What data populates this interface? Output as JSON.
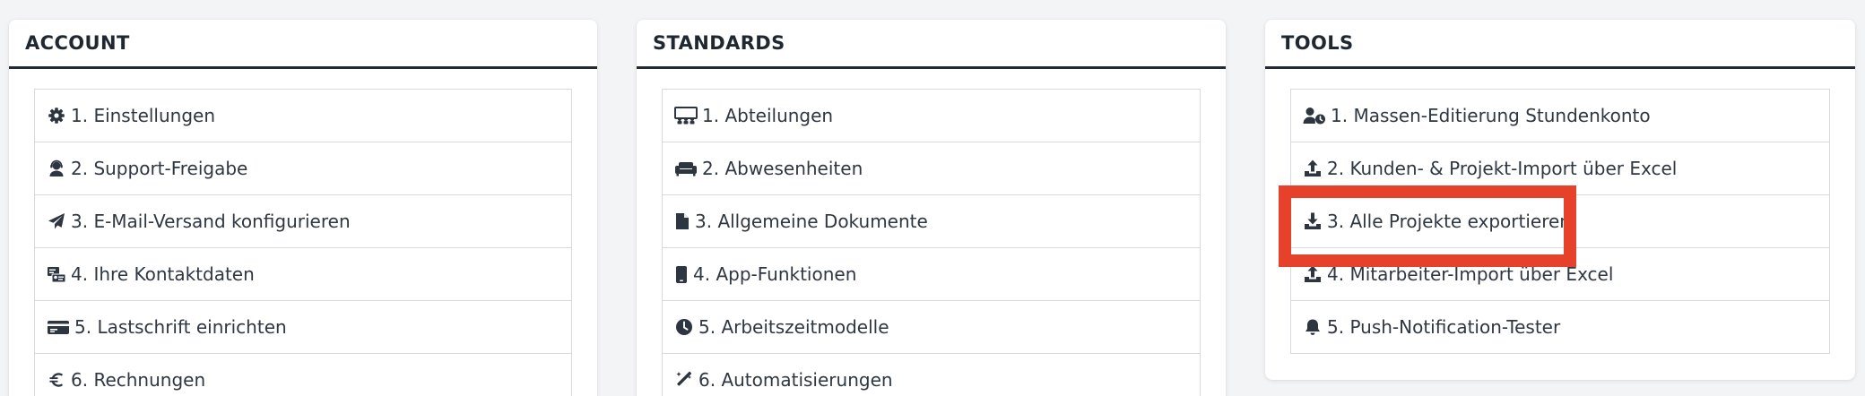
{
  "panels": [
    {
      "title": "ACCOUNT",
      "items": [
        {
          "label": "1. Einstellungen",
          "icon": "gear-icon"
        },
        {
          "label": "2. Support-Freigabe",
          "icon": "user-headset-icon"
        },
        {
          "label": "3. E-Mail-Versand konfigurieren",
          "icon": "paper-plane-icon"
        },
        {
          "label": "4. Ihre Kontaktdaten",
          "icon": "contact-card-icon"
        },
        {
          "label": "5. Lastschrift einrichten",
          "icon": "credit-card-icon"
        },
        {
          "label": "6. Rechnungen",
          "icon": "euro-icon"
        }
      ]
    },
    {
      "title": "STANDARDS",
      "items": [
        {
          "label": "1. Abteilungen",
          "icon": "presentation-icon"
        },
        {
          "label": "2. Abwesenheiten",
          "icon": "couch-icon"
        },
        {
          "label": "3. Allgemeine Dokumente",
          "icon": "file-icon"
        },
        {
          "label": "4. App-Funktionen",
          "icon": "mobile-icon"
        },
        {
          "label": "5. Arbeitszeitmodelle",
          "icon": "clock-icon"
        },
        {
          "label": "6. Automatisierungen",
          "icon": "magic-wand-icon"
        }
      ]
    },
    {
      "title": "TOOLS",
      "items": [
        {
          "label": "1. Massen-Editierung Stundenkonto",
          "icon": "user-clock-icon"
        },
        {
          "label": "2. Kunden- & Projekt-Import über Excel",
          "icon": "upload-icon"
        },
        {
          "label": "3. Alle Projekte exportieren",
          "icon": "download-icon"
        },
        {
          "label": "4. Mitarbeiter-Import über Excel",
          "icon": "upload-icon"
        },
        {
          "label": "5. Push-Notification-Tester",
          "icon": "bell-icon"
        }
      ]
    }
  ],
  "highlight_color": "#e5412b",
  "highlighted_item": "3. Alle Projekte exportieren"
}
